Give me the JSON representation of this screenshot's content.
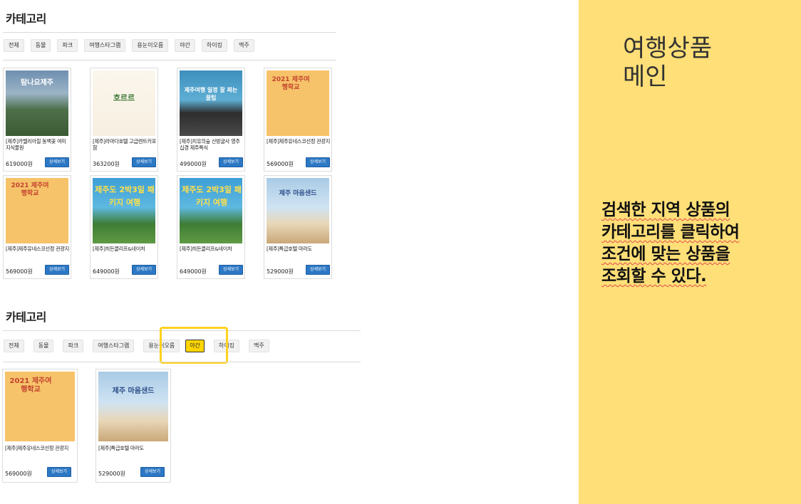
{
  "section1": {
    "title": "카테고리",
    "chips": [
      "전체",
      "동물",
      "파크",
      "여행스타그램",
      "용눈이오름",
      "야간",
      "하이킹",
      "맥주"
    ],
    "products": [
      {
        "name": "[제주]카멜리아힐 동백꽃 여미지식물원",
        "price": "619000원",
        "button": "상세보기",
        "thumb": "thumb-jeju-sea",
        "thumb_text": "탐나요제주"
      },
      {
        "name": "[제주]라마다호텔 고급렌트카포함",
        "price": "363200원",
        "button": "상세보기",
        "thumb": "thumb-camellia",
        "thumb_text": "호르르"
      },
      {
        "name": "[제주]치유의숲 산방굴사 영주십경 제주특식",
        "price": "499000원",
        "button": "상세보기",
        "thumb": "thumb-rocks",
        "thumb_text": "제주여행 일정 잘 짜는 꿀팁"
      },
      {
        "name": "[제주]제주유네스코선정 관광지",
        "price": "569000원",
        "button": "상세보기",
        "thumb": "thumb-school",
        "thumb_text": "2021 제주여행학교"
      },
      {
        "name": "[제주]제주유네스코선정 관광지",
        "price": "569000원",
        "button": "상세보기",
        "thumb": "thumb-school",
        "thumb_text": "2021 제주여행학교"
      },
      {
        "name": "[제주]히든클리프&네이처",
        "price": "649000원",
        "button": "상세보기",
        "thumb": "thumb-package",
        "thumb_text": "제주도 2박3일 패키지 여행"
      },
      {
        "name": "[제주]히든클리프&네이처",
        "price": "649000원",
        "button": "상세보기",
        "thumb": "thumb-package",
        "thumb_text": "제주도 2박3일 패키지 여행"
      },
      {
        "name": "[제주]특급호텔 마라도",
        "price": "529000원",
        "button": "상세보기",
        "thumb": "thumb-marado",
        "thumb_text": "제주 마음샌드"
      }
    ]
  },
  "section2": {
    "title": "카테고리",
    "chips": [
      "전체",
      "동물",
      "파크",
      "여행스타그램",
      "용눈이오름",
      "야간",
      "하이킹",
      "맥주"
    ],
    "active_chip": "야간",
    "products": [
      {
        "name": "[제주]제주유네스코선정 관광지",
        "price": "569000원",
        "button": "상세보기",
        "thumb": "thumb-school",
        "thumb_text": "2021 제주여행학교"
      },
      {
        "name": "[제주]특급호텔 마라도",
        "price": "529000원",
        "button": "상세보기",
        "thumb": "thumb-marado",
        "thumb_text": "제주 마음샌드"
      }
    ]
  },
  "side": {
    "title": "여행상품\n메인",
    "description": "검색한 지역 상품의\n카테고리를 클릭하여\n조건에 맞는 상품을\n조회할 수 있다."
  },
  "colors": {
    "panel": "#ffdf77",
    "highlight": "#ffd21f",
    "active_chip": "#ffd500",
    "detail_button": "#2d78c4"
  }
}
